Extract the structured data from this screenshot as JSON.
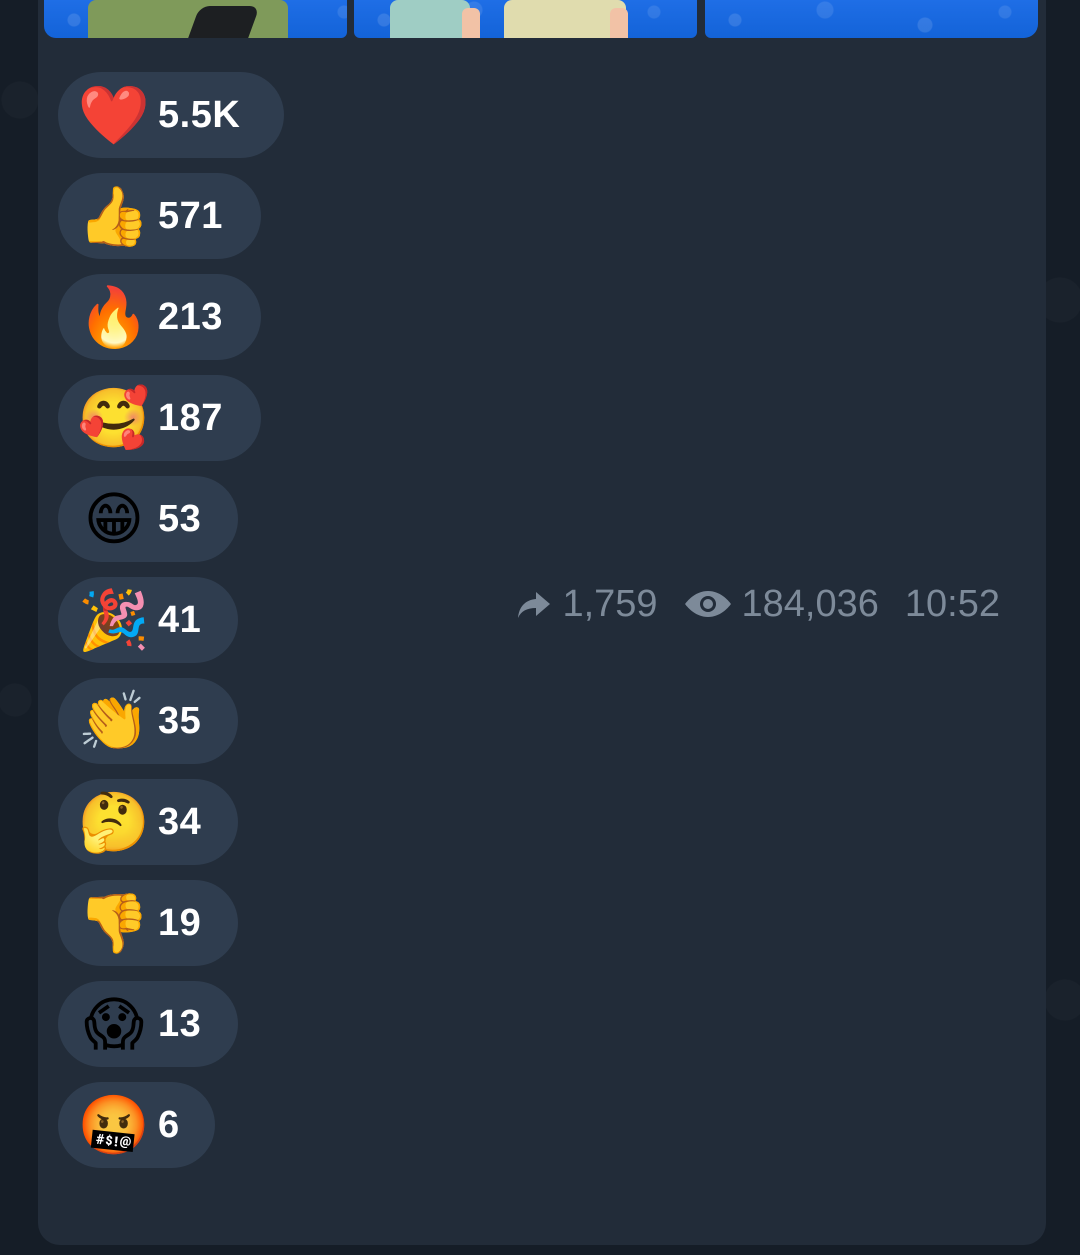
{
  "reactions": [
    {
      "emoji": "heart-icon",
      "glyph": "❤️",
      "count": "5.5K"
    },
    {
      "emoji": "thumbs-up-icon",
      "glyph": "👍",
      "count": "571"
    },
    {
      "emoji": "fire-icon",
      "glyph": "🔥",
      "count": "213"
    },
    {
      "emoji": "smiling-face-with-hearts-icon",
      "glyph": "🥰",
      "count": "187"
    },
    {
      "emoji": "grinning-face-icon",
      "glyph": "😁",
      "count": "53"
    },
    {
      "emoji": "party-popper-icon",
      "glyph": "🎉",
      "count": "41"
    },
    {
      "emoji": "clapping-hands-icon",
      "glyph": "👏",
      "count": "35"
    },
    {
      "emoji": "thinking-face-icon",
      "glyph": "🤔",
      "count": "34"
    },
    {
      "emoji": "thumbs-down-icon",
      "glyph": "👎",
      "count": "19"
    },
    {
      "emoji": "screaming-face-icon",
      "glyph": "😱",
      "count": "13"
    },
    {
      "emoji": "face-with-symbols-icon",
      "glyph": "🤬",
      "count": "6"
    }
  ],
  "meta": {
    "forwards": "1,759",
    "views": "184,036",
    "time": "10:52"
  },
  "colors": {
    "bubble": "#222c39",
    "pill": "#2f3d4f",
    "meta_text": "#7d8a99",
    "media_blue": "#1f6ee6"
  }
}
